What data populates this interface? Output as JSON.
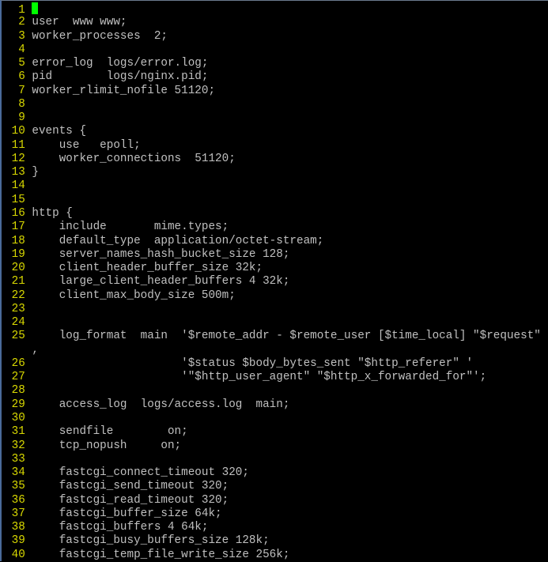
{
  "editor": {
    "cursor_color": "#00ff00",
    "line_number_color": "#d8d800",
    "text_color": "#c0c0c0",
    "cursor_line": 1,
    "lines": [
      {
        "n": "1",
        "text": ""
      },
      {
        "n": "2",
        "text": "user  www www;"
      },
      {
        "n": "3",
        "text": "worker_processes  2;"
      },
      {
        "n": "4",
        "text": ""
      },
      {
        "n": "5",
        "text": "error_log  logs/error.log;"
      },
      {
        "n": "6",
        "text": "pid        logs/nginx.pid;"
      },
      {
        "n": "7",
        "text": "worker_rlimit_nofile 51120;"
      },
      {
        "n": "8",
        "text": ""
      },
      {
        "n": "9",
        "text": ""
      },
      {
        "n": "10",
        "text": "events {"
      },
      {
        "n": "11",
        "text": "    use   epoll;"
      },
      {
        "n": "12",
        "text": "    worker_connections  51120;"
      },
      {
        "n": "13",
        "text": "}"
      },
      {
        "n": "14",
        "text": ""
      },
      {
        "n": "15",
        "text": ""
      },
      {
        "n": "16",
        "text": "http {"
      },
      {
        "n": "17",
        "text": "    include       mime.types;"
      },
      {
        "n": "18",
        "text": "    default_type  application/octet-stream;"
      },
      {
        "n": "19",
        "text": "    server_names_hash_bucket_size 128;"
      },
      {
        "n": "20",
        "text": "    client_header_buffer_size 32k;"
      },
      {
        "n": "21",
        "text": "    large_client_header_buffers 4 32k;"
      },
      {
        "n": "22",
        "text": "    client_max_body_size 500m;"
      },
      {
        "n": "23",
        "text": ""
      },
      {
        "n": "24",
        "text": ""
      },
      {
        "n": "25",
        "text": "    log_format  main  '$remote_addr - $remote_user [$time_local] \"$request\""
      },
      {
        "n": "",
        "text": ","
      },
      {
        "n": "26",
        "text": "                      '$status $body_bytes_sent \"$http_referer\" '"
      },
      {
        "n": "27",
        "text": "                      '\"$http_user_agent\" \"$http_x_forwarded_for\"';"
      },
      {
        "n": "28",
        "text": ""
      },
      {
        "n": "29",
        "text": "    access_log  logs/access.log  main;"
      },
      {
        "n": "30",
        "text": ""
      },
      {
        "n": "31",
        "text": "    sendfile        on;"
      },
      {
        "n": "32",
        "text": "    tcp_nopush     on;"
      },
      {
        "n": "33",
        "text": ""
      },
      {
        "n": "34",
        "text": "    fastcgi_connect_timeout 320;"
      },
      {
        "n": "35",
        "text": "    fastcgi_send_timeout 320;"
      },
      {
        "n": "36",
        "text": "    fastcgi_read_timeout 320;"
      },
      {
        "n": "37",
        "text": "    fastcgi_buffer_size 64k;"
      },
      {
        "n": "38",
        "text": "    fastcgi_buffers 4 64k;"
      },
      {
        "n": "39",
        "text": "    fastcgi_busy_buffers_size 128k;"
      },
      {
        "n": "40",
        "text": "    fastcgi_temp_file_write_size 256k;"
      }
    ]
  }
}
